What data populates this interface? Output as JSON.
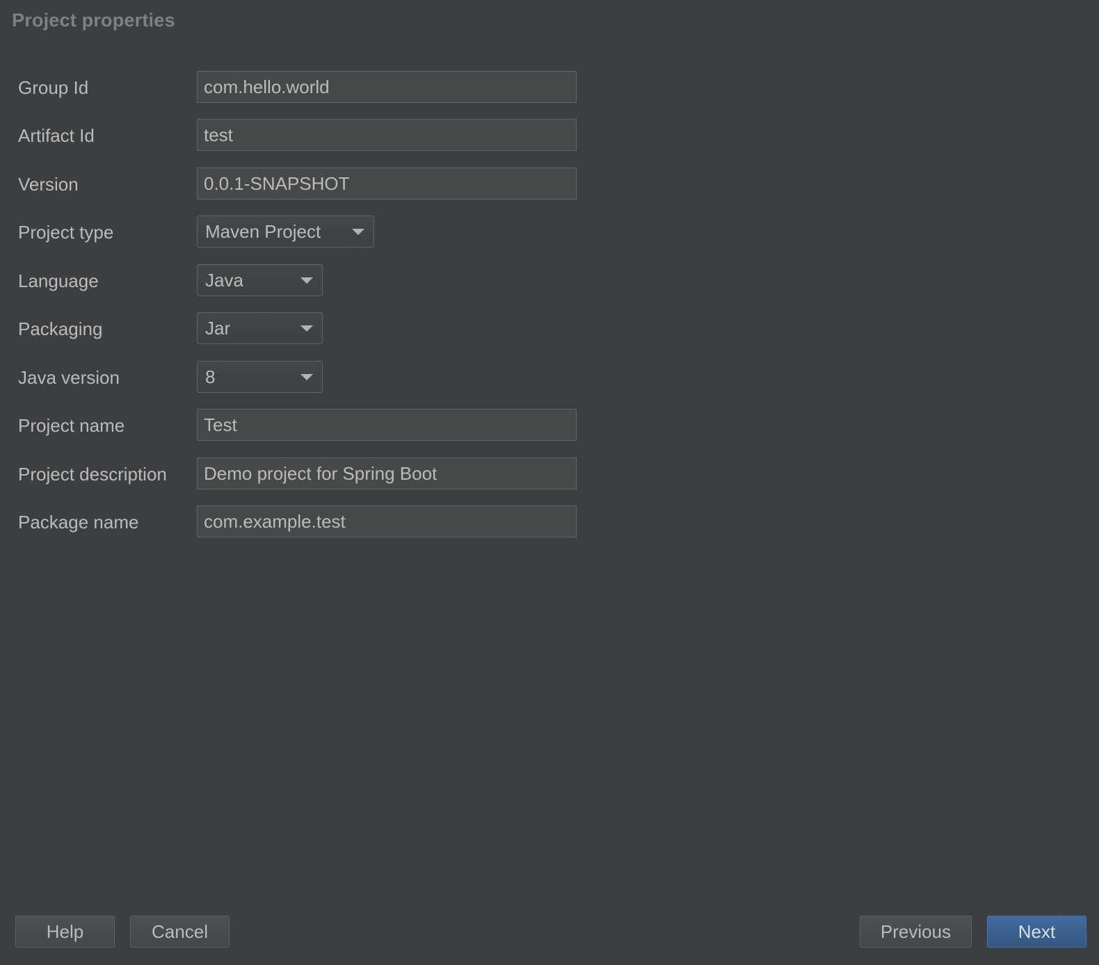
{
  "page": {
    "title": "Project properties"
  },
  "form": {
    "group_id": {
      "label": "Group Id",
      "value": "com.hello.world"
    },
    "artifact_id": {
      "label": "Artifact Id",
      "value": "test"
    },
    "version": {
      "label": "Version",
      "value": "0.0.1-SNAPSHOT"
    },
    "project_type": {
      "label": "Project type",
      "selected": "Maven Project"
    },
    "language": {
      "label": "Language",
      "selected": "Java"
    },
    "packaging": {
      "label": "Packaging",
      "selected": "Jar"
    },
    "java_version": {
      "label": "Java version",
      "selected": "8"
    },
    "project_name": {
      "label": "Project name",
      "value": "Test"
    },
    "project_description": {
      "label": "Project description",
      "value": "Demo project for Spring Boot"
    },
    "package_name": {
      "label": "Package name",
      "value": "com.example.test"
    }
  },
  "footer": {
    "help_label": "Help",
    "cancel_label": "Cancel",
    "previous_label": "Previous",
    "next_label": "Next"
  },
  "icons": {
    "dropdown": "chevron-down-icon"
  },
  "colors": {
    "background": "#3c3f41",
    "field_background": "#45494a",
    "primary_button": "#365880",
    "text": "#bbbbbb"
  }
}
